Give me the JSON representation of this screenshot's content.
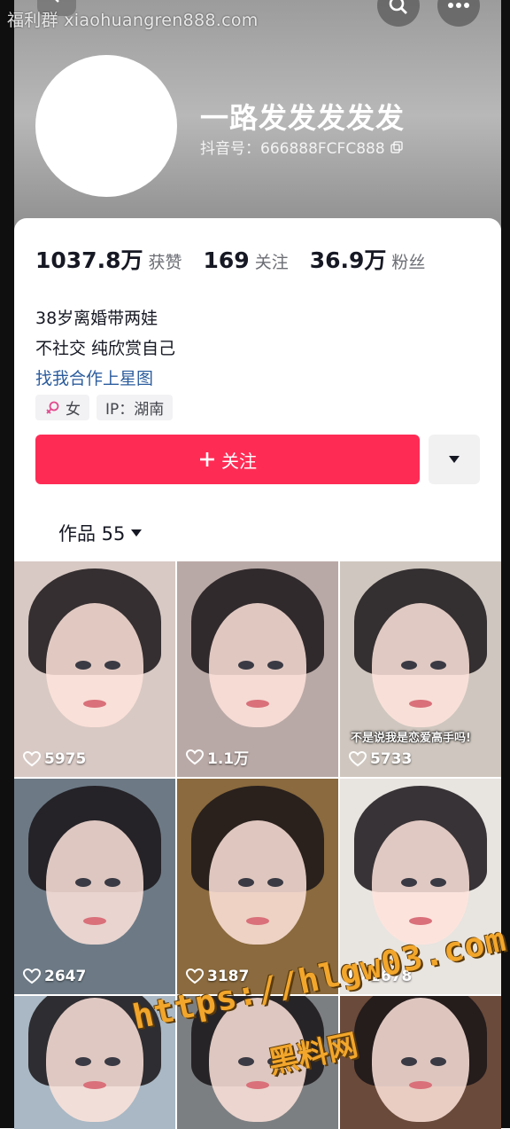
{
  "watermark": "福利群 xiaohuangren888.com",
  "profile": {
    "display_name": "一路发发发发发",
    "douyin_id": "抖音号：666888FCFC888"
  },
  "stats": [
    {
      "value": "1037.8万",
      "label": "获赞"
    },
    {
      "value": "169",
      "label": "关注"
    },
    {
      "value": "36.9万",
      "label": "粉丝"
    }
  ],
  "bio": {
    "line1": "38岁离婚带两娃",
    "line2": "不社交 纯欣赏自己",
    "link": "找我合作上星图"
  },
  "tags": {
    "gender_icon": "female-icon",
    "gender": "女",
    "ip": "IP：湖南"
  },
  "actions": {
    "follow_label": "关注",
    "follow_color": "#fe2c55"
  },
  "works_tab": {
    "label": "作品 55"
  },
  "videos": [
    {
      "likes": "5975",
      "bg": "#d8c9c4",
      "caption": ""
    },
    {
      "likes": "1.1万",
      "bg": "#b9a9a6",
      "caption": ""
    },
    {
      "likes": "5733",
      "bg": "#cfc7bf",
      "caption": "不是说我是恋爱高手吗!"
    },
    {
      "likes": "2647",
      "bg": "#6d7a86",
      "caption": ""
    },
    {
      "likes": "3187",
      "bg": "#8a6a3e",
      "caption": ""
    },
    {
      "likes": "2678",
      "bg": "#e8e4e0",
      "caption": ""
    },
    {
      "likes": "",
      "bg": "#a9b8c4",
      "caption": ""
    },
    {
      "likes": "",
      "bg": "#7c7f82",
      "caption": ""
    },
    {
      "likes": "",
      "bg": "#6a4a3a",
      "caption": ""
    }
  ],
  "overlay": {
    "url": "https://hlgw03.com",
    "brand": "黑料网"
  }
}
